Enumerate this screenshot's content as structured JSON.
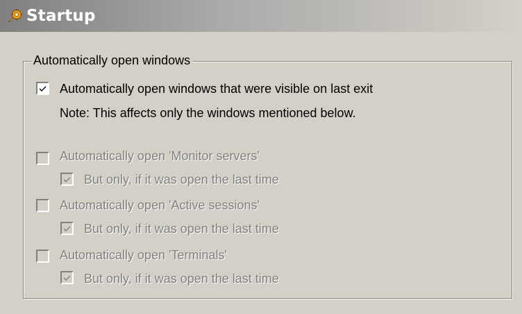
{
  "header": {
    "title": "Startup",
    "icon": "startup-gear-icon"
  },
  "group": {
    "legend": "Automatically open windows"
  },
  "main_option": {
    "label": "Automatically open windows that were visible on last exit",
    "checked": true,
    "note": "Note: This affects only the windows mentioned below."
  },
  "windows": [
    {
      "label": "Automatically open 'Monitor servers'",
      "checked": false,
      "enabled": false,
      "sub_label": "But only, if it was open the last time",
      "sub_checked": true
    },
    {
      "label": "Automatically open 'Active sessions'",
      "checked": false,
      "enabled": false,
      "sub_label": "But only, if it was open the last time",
      "sub_checked": true
    },
    {
      "label": "Automatically open 'Terminals'",
      "checked": false,
      "enabled": false,
      "sub_label": "But only, if it was open the last time",
      "sub_checked": true
    }
  ],
  "colors": {
    "background": "#d4d0c8",
    "header_text": "#ffffff",
    "disabled_text": "#808080"
  }
}
